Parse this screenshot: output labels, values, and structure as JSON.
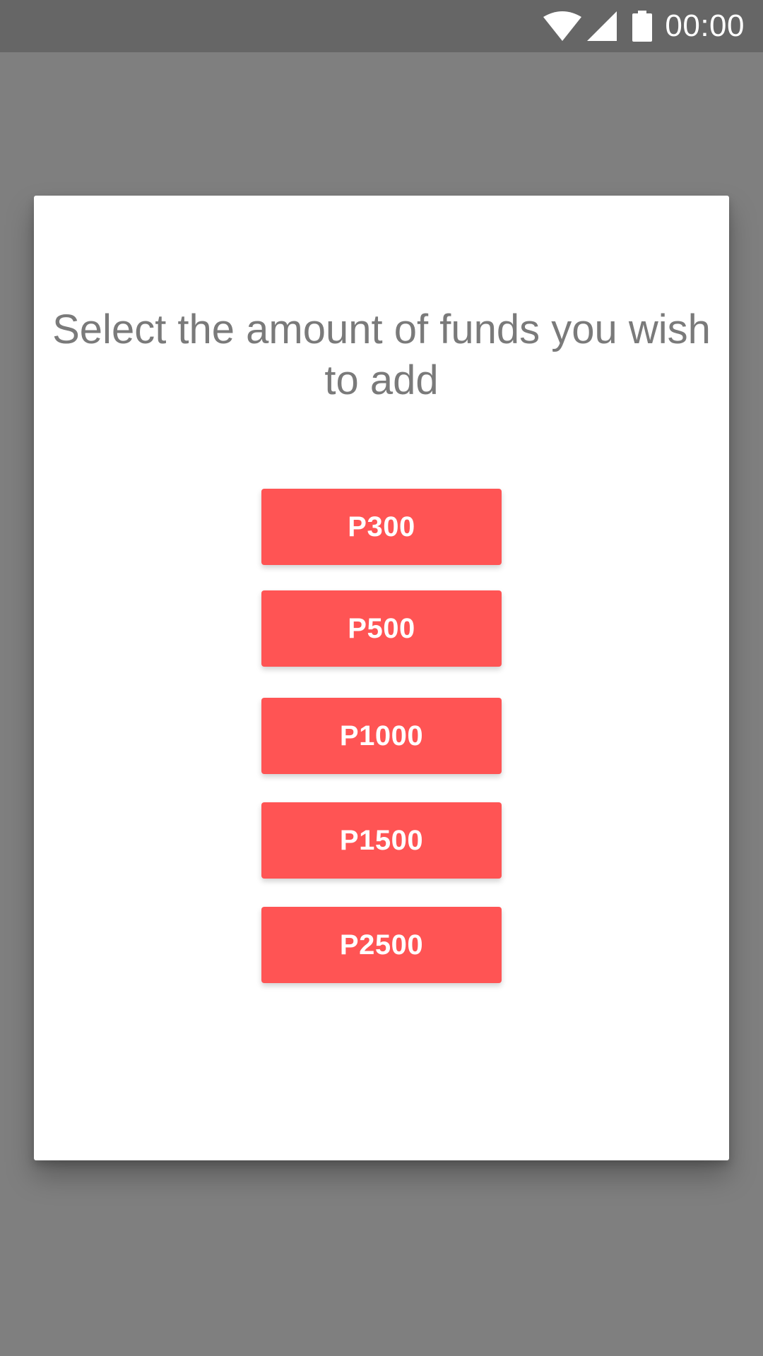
{
  "status_bar": {
    "time": "00:00",
    "icons": [
      "wifi-icon",
      "cell-signal-icon",
      "battery-icon"
    ],
    "background": "#666666"
  },
  "dialog": {
    "title": "Select the amount of funds you wish to add",
    "amounts": [
      "P300",
      "P500",
      "P1000",
      "P1500",
      "P2500"
    ]
  },
  "colors": {
    "scrim": "#7f7f7f",
    "button": "#ff5454",
    "button_text": "#ffffff",
    "title_text": "#7a7a7a"
  }
}
